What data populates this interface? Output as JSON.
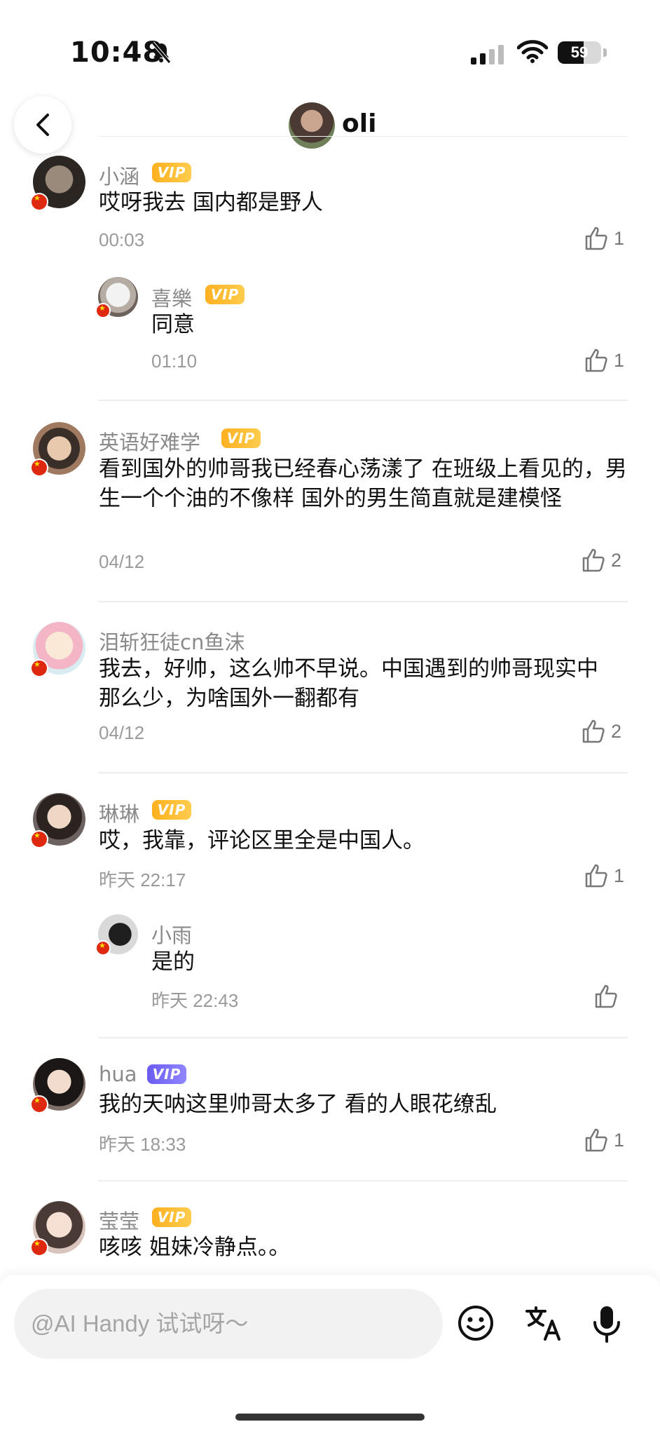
{
  "status": {
    "time": "10:48",
    "battery": "59",
    "battery_level": 0.59
  },
  "header": {
    "name": "oli"
  },
  "comments": [
    {
      "user": "小涵",
      "vip": "VIP",
      "text": "哎呀我去 国内都是野人",
      "time": "00:03",
      "likes": "1"
    },
    {
      "user": "喜樂",
      "vip": "VIP",
      "text": "同意",
      "time": "01:10",
      "likes": "1"
    },
    {
      "user": "英语好难学",
      "vip": "VIP",
      "text": "看到国外的帅哥我已经春心荡漾了 在班级上看见的，男生一个个油的不像样 国外的男生简直就是建模怪",
      "time": "04/12",
      "likes": "2"
    },
    {
      "user": "泪斩狂徒cn鱼沫",
      "text": "我去，好帅，这么帅不早说。中国遇到的帅哥现实中那么少，为啥国外一翻都有",
      "time": "04/12",
      "likes": "2"
    },
    {
      "user": "琳琳",
      "vip": "VIP",
      "text": "哎，我靠，评论区里全是中国人。",
      "time": "昨天 22:17",
      "likes": "1"
    },
    {
      "user": "小雨",
      "text": "是的",
      "time": "昨天 22:43",
      "likes": ""
    },
    {
      "user": "hua",
      "vip": "VIP",
      "text": "我的天呐这里帅哥太多了 看的人眼花缭乱",
      "time": "昨天 18:33",
      "likes": "1"
    },
    {
      "user": "莹莹",
      "vip": "VIP",
      "text": "咳咳 姐妹冷静点。。"
    }
  ],
  "input": {
    "placeholder": "@AI Handy 试试呀～"
  },
  "icons": {
    "back": "back-arrow-icon",
    "like": "thumbs-up-icon",
    "emoji": "emoji-icon",
    "translate": "translate-icon",
    "mic": "microphone-icon"
  },
  "colors": {
    "vip_gold": "#ffb020",
    "vip_blue": "#6b5cf0",
    "flag_red": "#de2910"
  }
}
